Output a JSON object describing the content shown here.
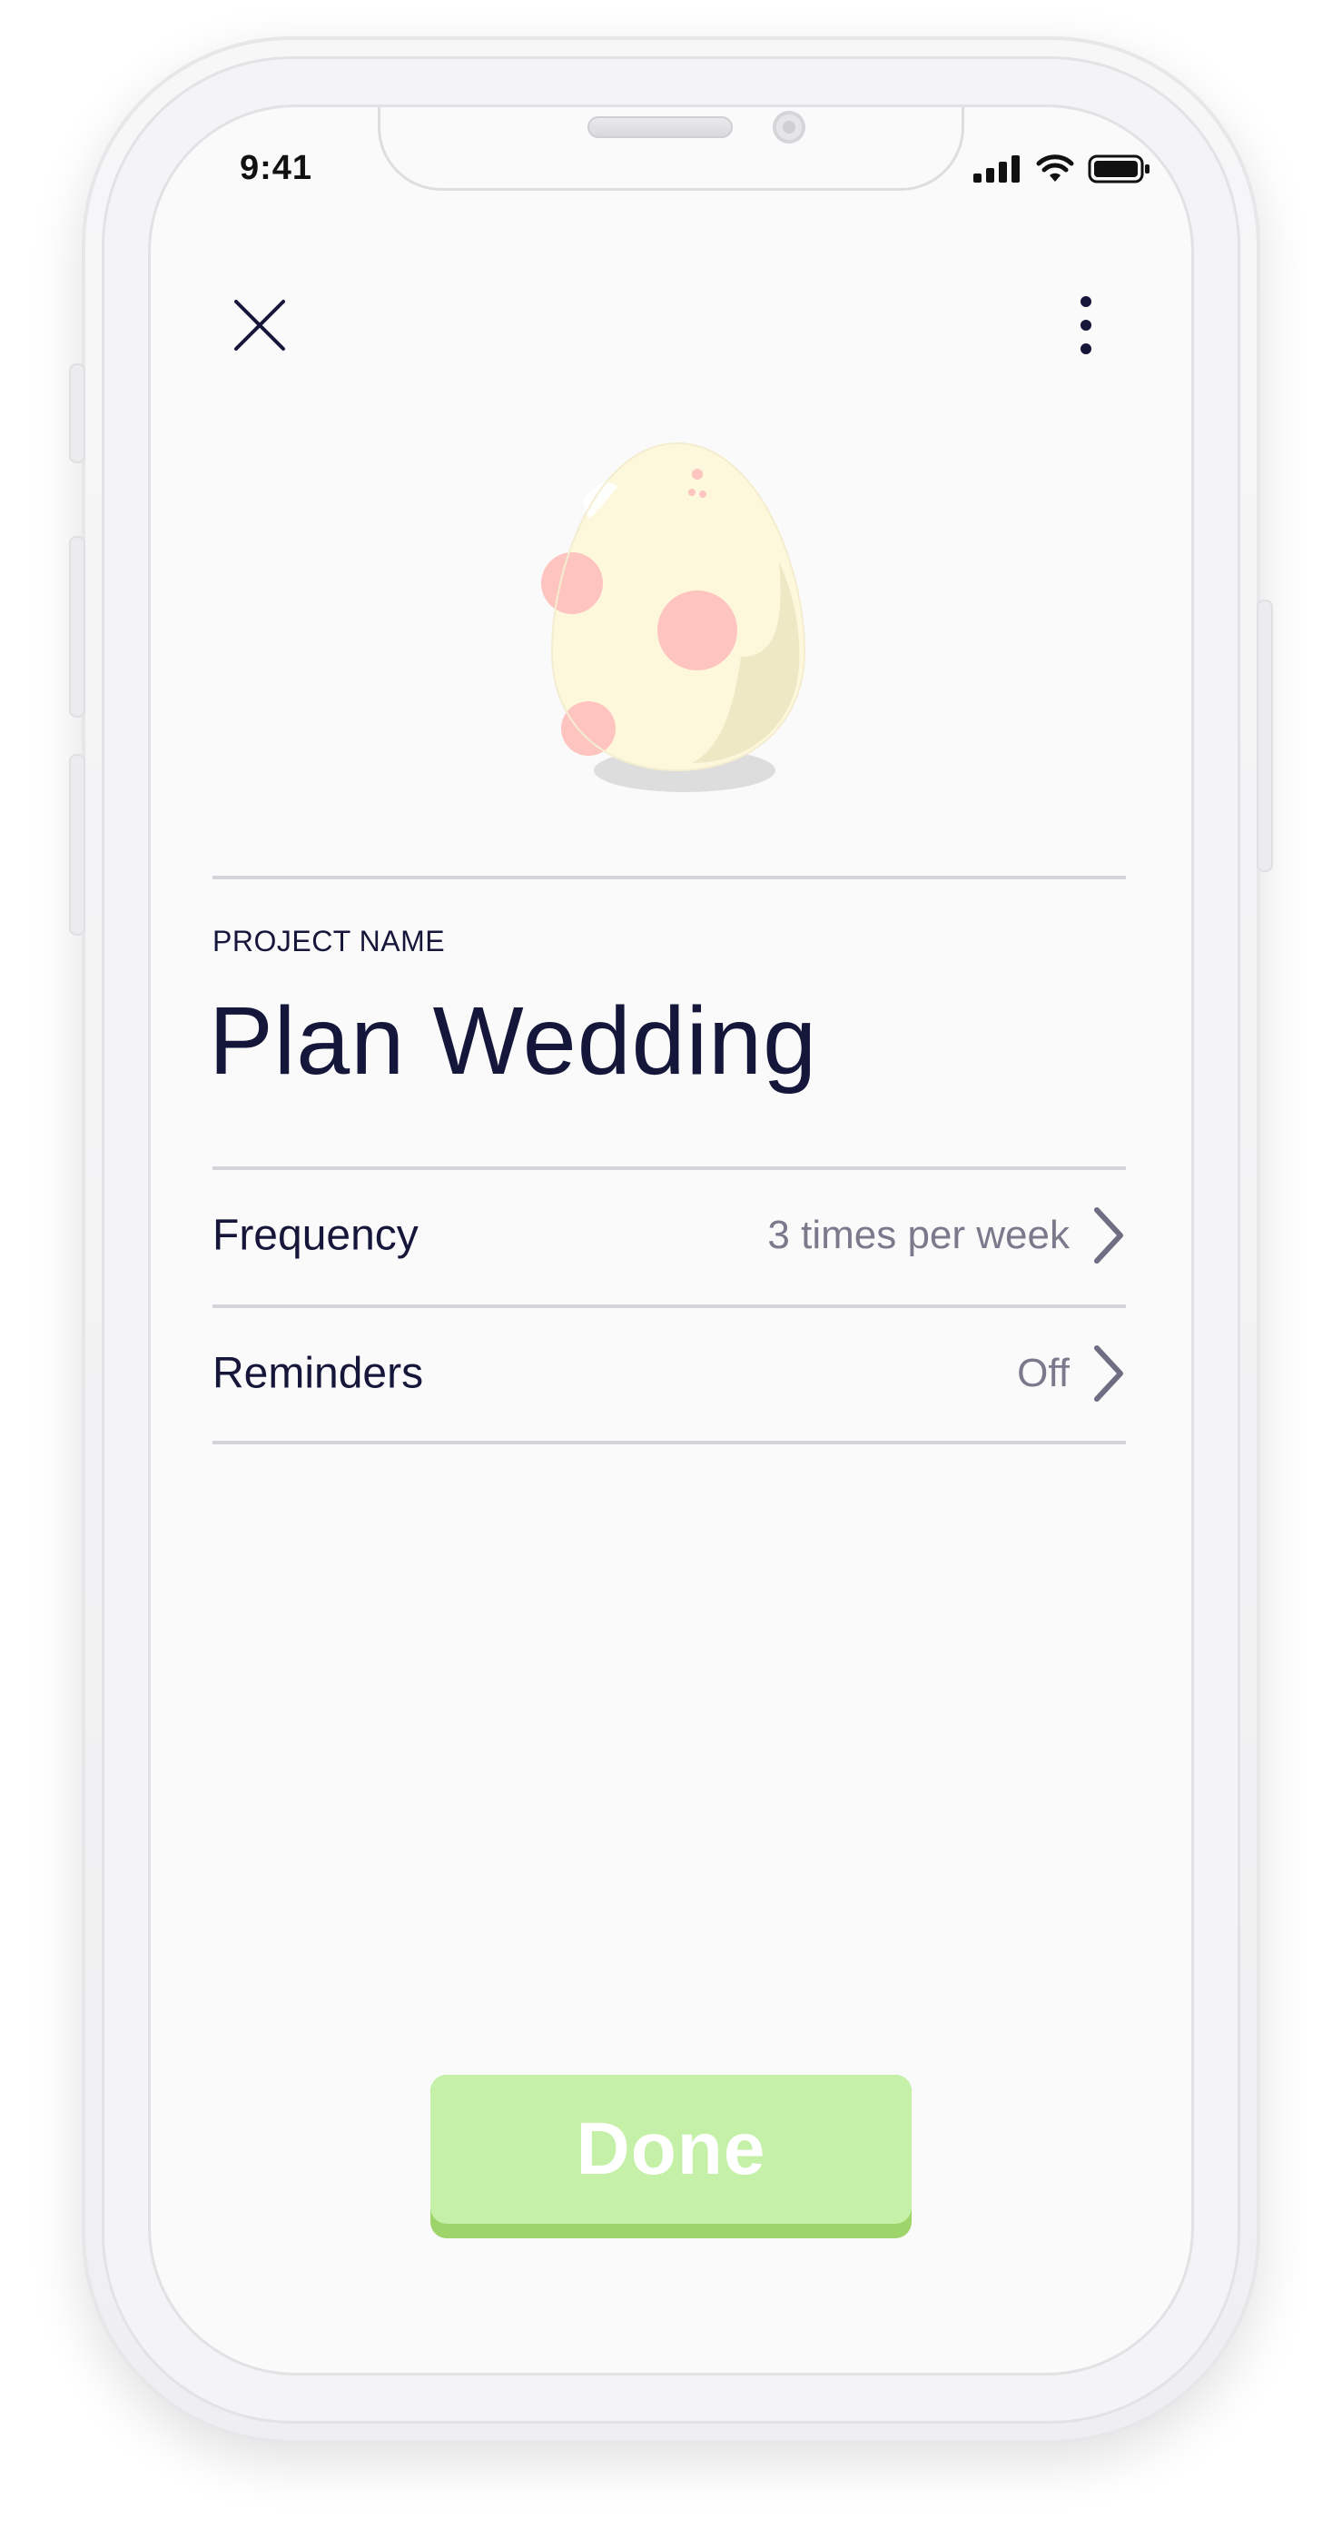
{
  "status_bar": {
    "time": "9:41"
  },
  "header": {
    "close_icon": "close-icon",
    "more_icon": "more-vertical-icon"
  },
  "project": {
    "name_label": "PROJECT NAME",
    "name": "Plan Wedding"
  },
  "settings": [
    {
      "label": "Frequency",
      "value": "3 times per week"
    },
    {
      "label": "Reminders",
      "value": "Off"
    }
  ],
  "actions": {
    "done_label": "Done"
  },
  "colors": {
    "text_primary": "#16163a",
    "text_secondary": "#7a7a8c",
    "button_face": "#c5f0a8",
    "button_edge": "#9ed56a",
    "egg_shell": "#fdf7dc",
    "egg_spots": "#fec4c0"
  }
}
